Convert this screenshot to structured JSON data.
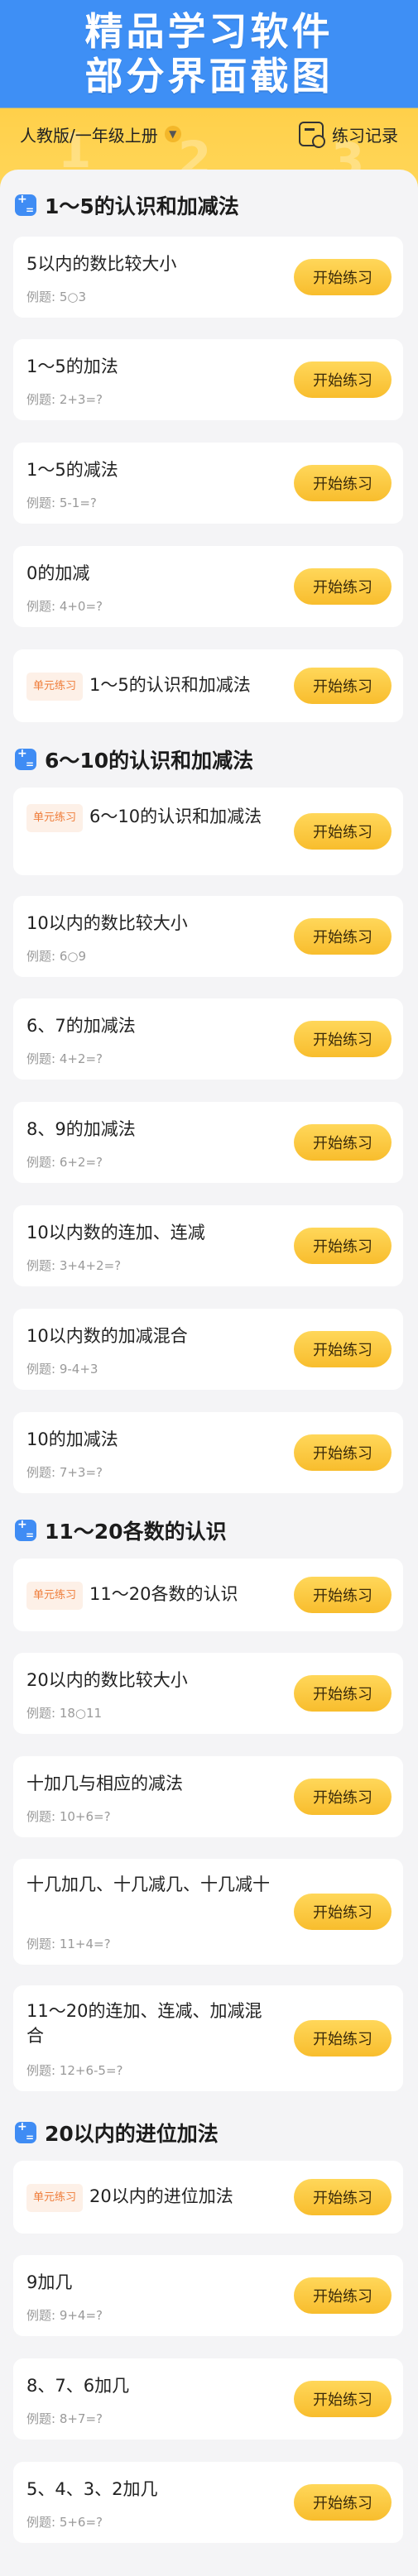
{
  "hero": {
    "line1": "精品学习软件",
    "line2": "部分界面截图",
    "deco": [
      "1",
      "2",
      "3"
    ]
  },
  "header": {
    "edition": "人教版/一年级上册",
    "record": "练习记录"
  },
  "button_label": "开始练习",
  "unit_tag": "单元练习",
  "sections": [
    {
      "title": "1～5的认识和加减法",
      "items": [
        {
          "title": "5以内的数比较大小",
          "example": "例题: 5○3"
        },
        {
          "title": "1～5的加法",
          "example": "例题: 2+3=?"
        },
        {
          "title": "1～5的减法",
          "example": "例题: 5-1=?"
        },
        {
          "title": "0的加减",
          "example": "例题: 4+0=?"
        },
        {
          "title": "1～5的认识和加减法",
          "unit": true
        }
      ]
    },
    {
      "title": "6～10的认识和加减法",
      "items": [
        {
          "title": "6～10的认识和加减法",
          "unit": true
        },
        {
          "title": "10以内的数比较大小",
          "example": "例题: 6○9"
        },
        {
          "title": "6、7的加减法",
          "example": "例题: 4+2=?"
        },
        {
          "title": "8、9的加减法",
          "example": "例题: 6+2=?"
        },
        {
          "title": "10以内数的连加、连减",
          "example": "例题: 3+4+2=?"
        },
        {
          "title": "10以内数的加减混合",
          "example": "例题: 9-4+3"
        },
        {
          "title": "10的加减法",
          "example": "例题: 7+3=?"
        }
      ]
    },
    {
      "title": "11～20各数的认识",
      "items": [
        {
          "title": "11～20各数的认识",
          "unit": true
        },
        {
          "title": "20以内的数比较大小",
          "example": "例题: 18○11"
        },
        {
          "title": "十加几与相应的减法",
          "example": "例题: 10+6=?"
        },
        {
          "title": "十几加几、十几减几、十几减十",
          "example": "例题: 11+4=?"
        },
        {
          "title": "11～20的连加、连减、加减混合",
          "example": "例题: 12+6-5=?"
        }
      ]
    },
    {
      "title": "20以内的进位加法",
      "items": [
        {
          "title": "20以内的进位加法",
          "unit": true
        },
        {
          "title": "9加几",
          "example": "例题: 9+4=?"
        },
        {
          "title": "8、7、6加几",
          "example": "例题: 8+7=?"
        },
        {
          "title": "5、4、3、2加几",
          "example": "例题: 5+6=?"
        }
      ]
    }
  ]
}
